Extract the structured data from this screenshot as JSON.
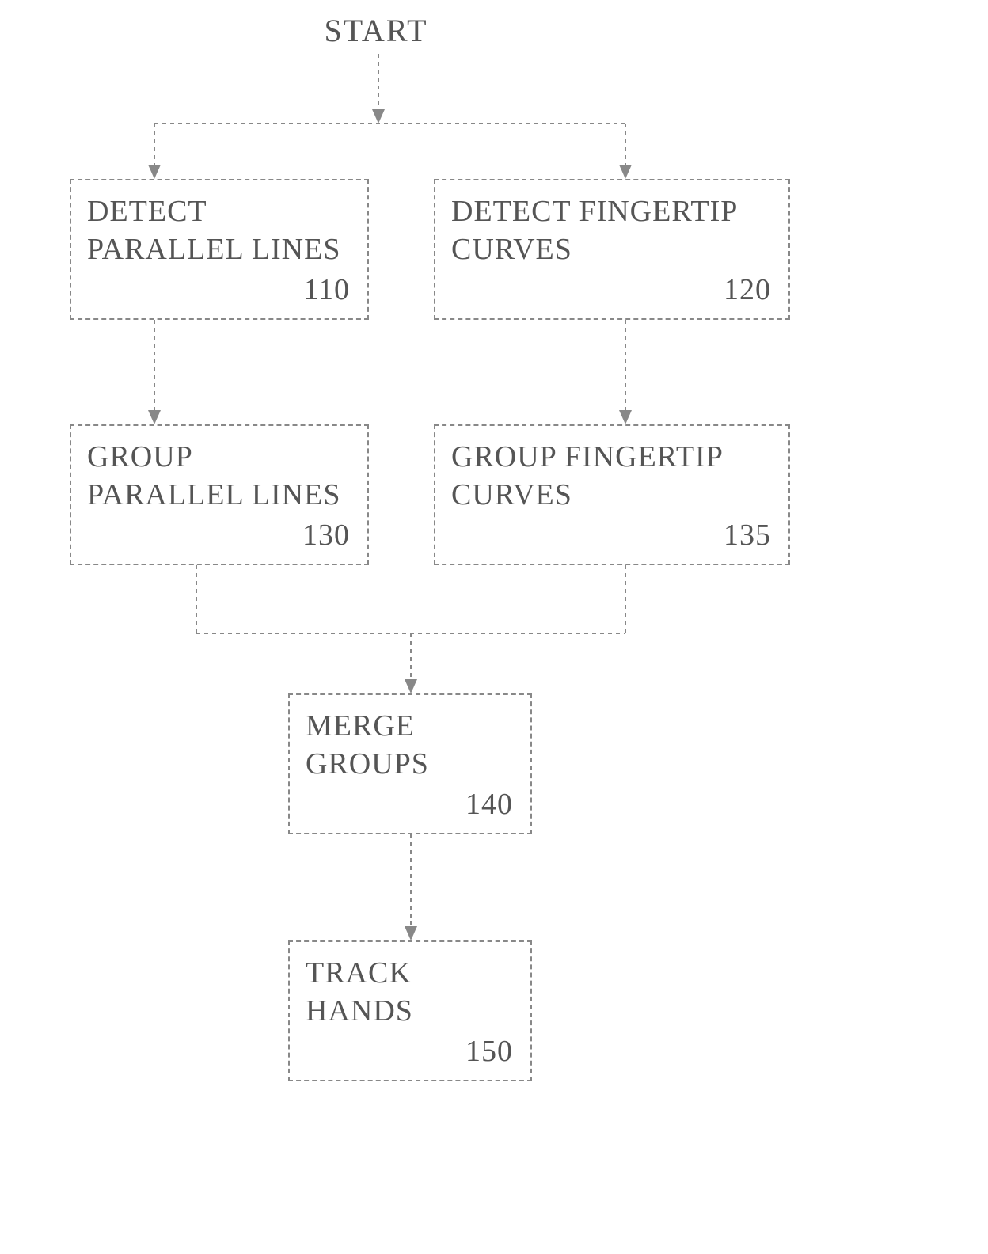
{
  "start_label": "START",
  "boxes": {
    "b110": {
      "text": "DETECT PARALLEL LINES",
      "num": "110"
    },
    "b120": {
      "text": "DETECT FINGERTIP CURVES",
      "num": "120"
    },
    "b130": {
      "text": "GROUP PARALLEL LINES",
      "num": "130"
    },
    "b135": {
      "text": "GROUP FINGERTIP CURVES",
      "num": "135"
    },
    "b140": {
      "text": "MERGE GROUPS",
      "num": "140"
    },
    "b150": {
      "text": "TRACK HANDS",
      "num": "150"
    }
  },
  "chart_data": {
    "type": "flowchart",
    "nodes": [
      {
        "id": "start",
        "kind": "terminator",
        "label": "START"
      },
      {
        "id": "110",
        "kind": "process",
        "label": "DETECT PARALLEL LINES"
      },
      {
        "id": "120",
        "kind": "process",
        "label": "DETECT FINGERTIP CURVES"
      },
      {
        "id": "130",
        "kind": "process",
        "label": "GROUP PARALLEL LINES"
      },
      {
        "id": "135",
        "kind": "process",
        "label": "GROUP FINGERTIP CURVES"
      },
      {
        "id": "140",
        "kind": "process",
        "label": "MERGE GROUPS"
      },
      {
        "id": "150",
        "kind": "process",
        "label": "TRACK HANDS"
      }
    ],
    "edges": [
      {
        "from": "start",
        "to": "110"
      },
      {
        "from": "start",
        "to": "120"
      },
      {
        "from": "110",
        "to": "130"
      },
      {
        "from": "120",
        "to": "135"
      },
      {
        "from": "130",
        "to": "140"
      },
      {
        "from": "135",
        "to": "140"
      },
      {
        "from": "140",
        "to": "150"
      }
    ]
  }
}
